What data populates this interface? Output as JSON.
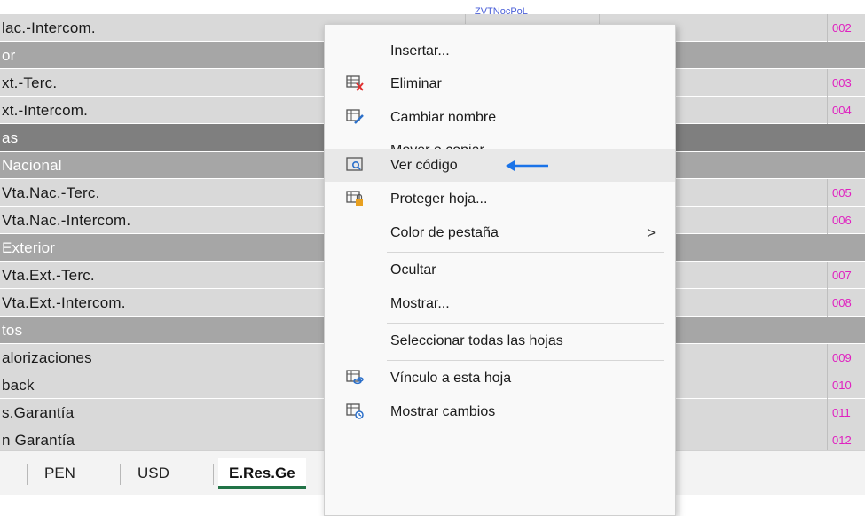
{
  "sheet": {
    "top_partial_text": "ZVTNocPoL",
    "rows": [
      {
        "label": "lac.-Intercom.",
        "code": "002",
        "type": "data"
      },
      {
        "label": "or",
        "code": "",
        "type": "group"
      },
      {
        "label": "xt.-Terc.",
        "code": "003",
        "type": "data"
      },
      {
        "label": "xt.-Intercom.",
        "code": "004",
        "type": "data"
      },
      {
        "label": "as",
        "code": "",
        "type": "group-dark"
      },
      {
        "label": "Nacional",
        "code": "",
        "type": "group"
      },
      {
        "label": "Vta.Nac.-Terc.",
        "code": "005",
        "type": "data"
      },
      {
        "label": "Vta.Nac.-Intercom.",
        "code": "006",
        "type": "data"
      },
      {
        "label": "Exterior",
        "code": "",
        "type": "group"
      },
      {
        "label": "Vta.Ext.-Terc.",
        "code": "007",
        "type": "data"
      },
      {
        "label": "Vta.Ext.-Intercom.",
        "code": "008",
        "type": "data"
      },
      {
        "label": "tos",
        "code": "",
        "type": "group"
      },
      {
        "label": "alorizaciones",
        "code": "009",
        "type": "data"
      },
      {
        "label": "back",
        "code": "010",
        "type": "data"
      },
      {
        "label": "s.Garantía",
        "code": "011",
        "type": "data"
      },
      {
        "label": "n Garantía",
        "code": "012",
        "type": "data"
      }
    ]
  },
  "tabs": {
    "items": [
      "PEN",
      "USD",
      "E.Res.Ge"
    ]
  },
  "menu": {
    "items": [
      {
        "label": "Insertar...",
        "icon": "none"
      },
      {
        "label": "Eliminar",
        "icon": "delete-sheet-icon"
      },
      {
        "label": "Cambiar nombre",
        "icon": "rename-sheet-icon"
      },
      {
        "label": "Mover o copiar...",
        "icon": "none"
      },
      {
        "label": "Ver código",
        "icon": "view-code-icon"
      },
      {
        "label": "Proteger hoja...",
        "icon": "protect-sheet-icon"
      },
      {
        "label": "Color de pestaña",
        "icon": "none",
        "submenu": true
      },
      {
        "label": "Ocultar",
        "icon": "none"
      },
      {
        "label": "Mostrar...",
        "icon": "none"
      },
      {
        "label": "Seleccionar todas las hojas",
        "icon": "none"
      },
      {
        "label": "Vínculo a esta hoja",
        "icon": "link-sheet-icon"
      },
      {
        "label": "Mostrar cambios",
        "icon": "show-changes-icon"
      }
    ],
    "submenu_glyph": ">"
  },
  "colors": {
    "accent_arrow": "#1a73e8",
    "code_text": "#e020c0",
    "active_tab_underline": "#217346"
  }
}
